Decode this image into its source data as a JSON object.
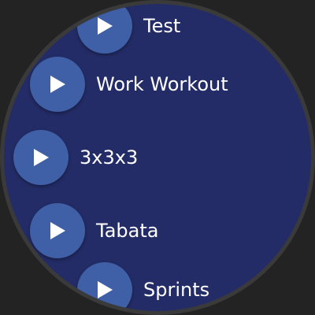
{
  "workouts": [
    {
      "label": "Test",
      "icon": "play-icon"
    },
    {
      "label": "Work Workout",
      "icon": "play-icon"
    },
    {
      "label": "3x3x3",
      "icon": "play-icon"
    },
    {
      "label": "Tabata",
      "icon": "play-icon"
    },
    {
      "label": "Sprints",
      "icon": "play-icon"
    }
  ],
  "colors": {
    "background": "#232c66",
    "bezel": "#3a3a3a",
    "button": "#3f5fa6",
    "text": "#ffffff"
  }
}
